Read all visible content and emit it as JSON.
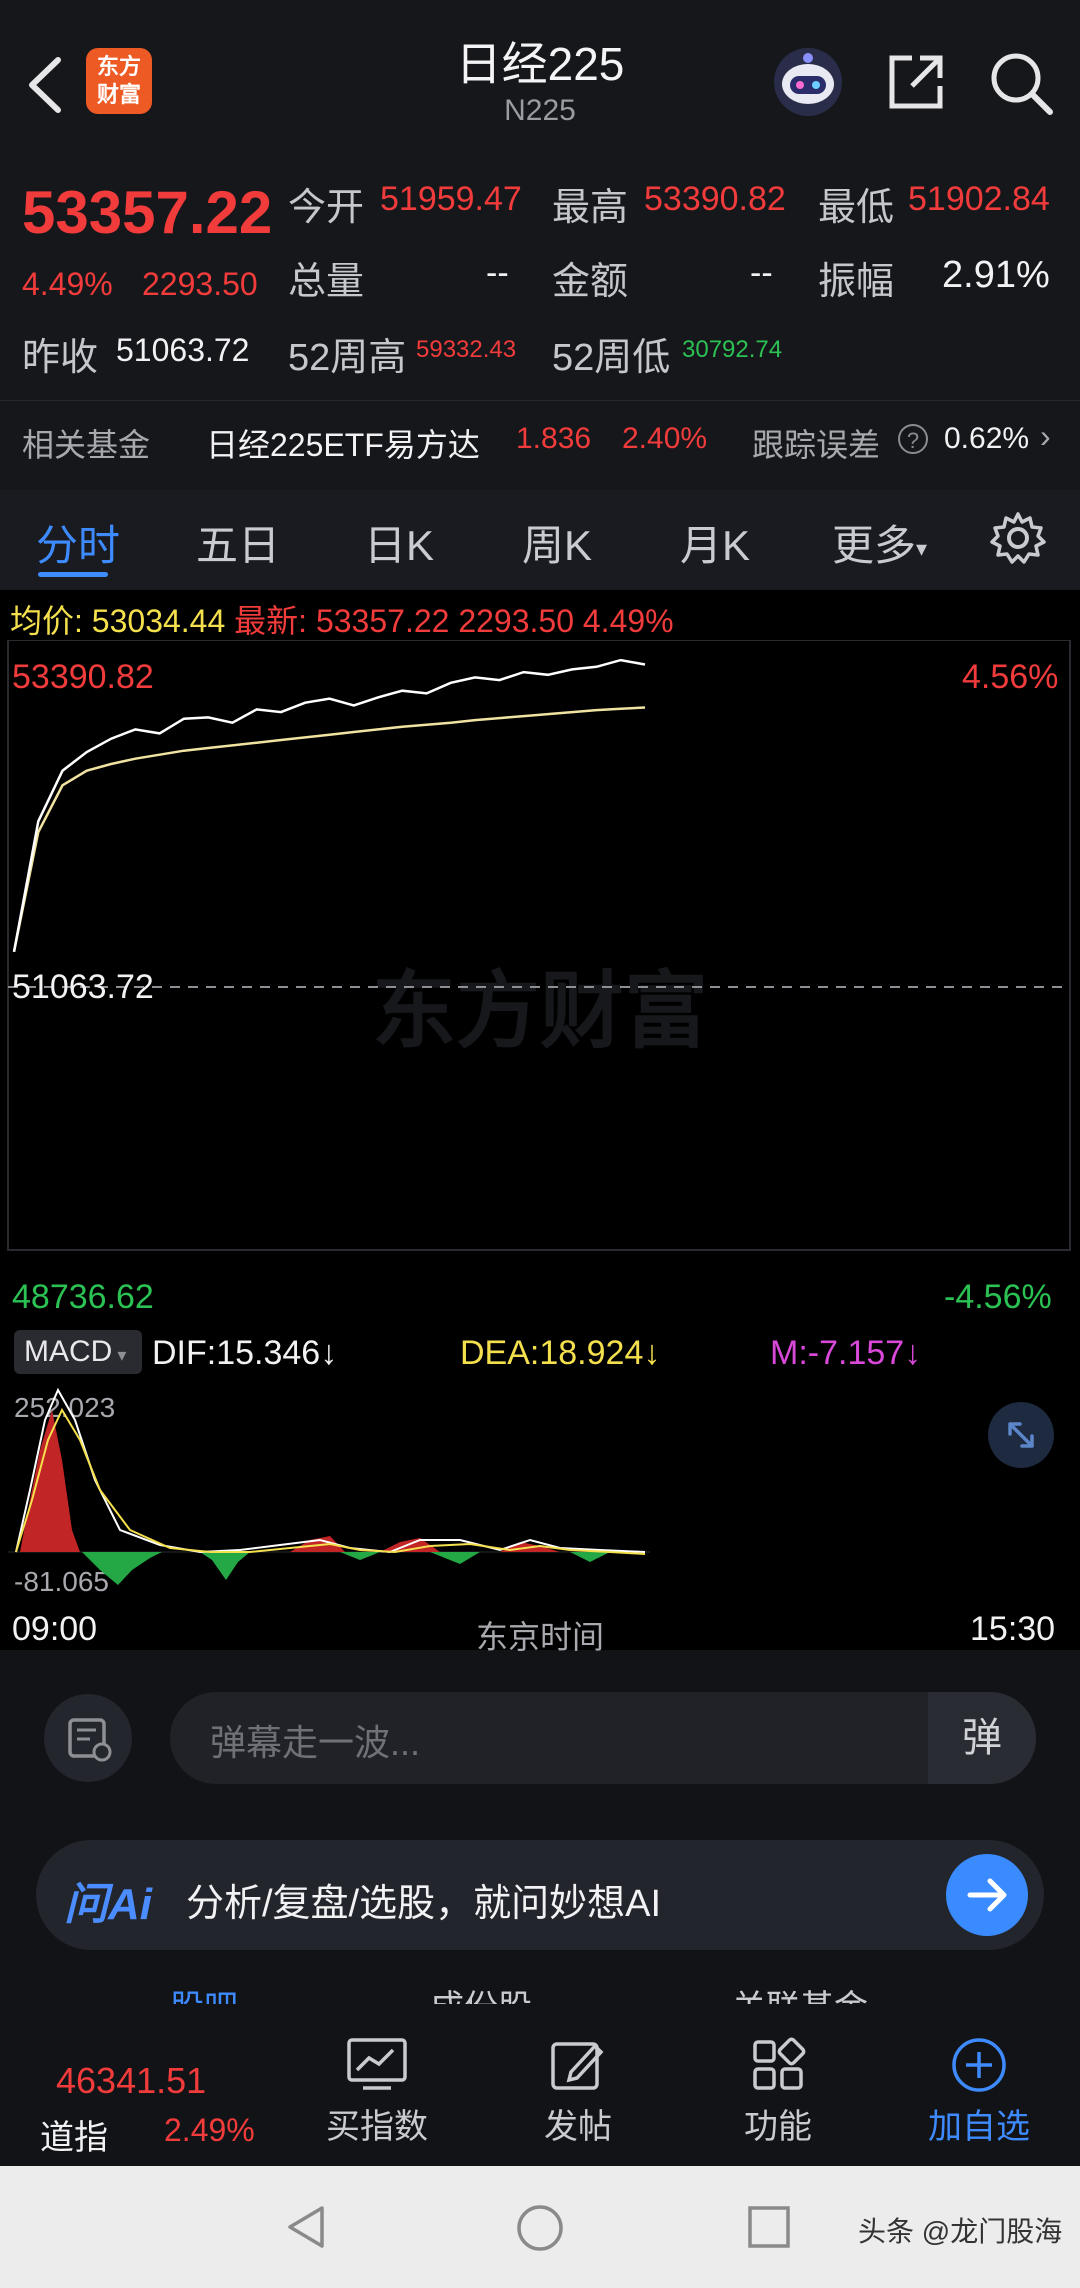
{
  "header": {
    "title": "日经225",
    "subtitle": "N225",
    "logo_text_1": "东方",
    "logo_text_2": "财富"
  },
  "quote": {
    "price": "53357.22",
    "change_pct": "4.49%",
    "change_amt": "2293.50",
    "open_label": "今开",
    "open": "51959.47",
    "high_label": "最高",
    "high": "53390.82",
    "low_label": "最低",
    "low": "51902.84",
    "volume_label": "总量",
    "volume": "--",
    "amount_label": "金额",
    "amount": "--",
    "amplitude_label": "振幅",
    "amplitude": "2.91%",
    "prev_close_label": "昨收",
    "prev_close": "51063.72",
    "w52_high_label": "52周高",
    "w52_high": "59332.43",
    "w52_low_label": "52周低",
    "w52_low": "30792.74"
  },
  "related_fund": {
    "label": "相关基金",
    "name": "日经225ETF易方达",
    "price": "1.836",
    "pct": "2.40%",
    "tracking_label": "跟踪误差",
    "tracking": "0.62%"
  },
  "tabs": [
    {
      "label": "分时"
    },
    {
      "label": "五日"
    },
    {
      "label": "日K"
    },
    {
      "label": "周K"
    },
    {
      "label": "月K"
    },
    {
      "label": "更多"
    }
  ],
  "chart_info": {
    "avg_label": "均价:",
    "avg": "53034.44",
    "latest_label": "最新:",
    "latest": "53357.22",
    "chg": "2293.50",
    "pct": "4.49%"
  },
  "chart_data": {
    "type": "line",
    "y_top": "53390.82",
    "y_mid": "51063.72",
    "y_bottom": "48736.62",
    "pct_top": "4.56%",
    "pct_bottom": "-4.56%",
    "watermark": "东方财富",
    "series": [
      {
        "name": "最新",
        "color": "#ffffff",
        "values": [
          51200,
          52180,
          52560,
          52700,
          52800,
          52870,
          52840,
          52950,
          52960,
          52920,
          53020,
          53000,
          53070,
          53100,
          53050,
          53110,
          53160,
          53140,
          53220,
          53260,
          53240,
          53300,
          53280,
          53320,
          53340,
          53390,
          53357
        ]
      },
      {
        "name": "均价",
        "color": "#f0e2a0",
        "values": [
          51200,
          52100,
          52450,
          52560,
          52610,
          52650,
          52680,
          52710,
          52730,
          52750,
          52770,
          52790,
          52810,
          52830,
          52850,
          52870,
          52890,
          52905,
          52920,
          52940,
          52955,
          52970,
          52985,
          53000,
          53015,
          53025,
          53034
        ]
      }
    ]
  },
  "macd": {
    "label": "MACD",
    "dif": "DIF:15.346↓",
    "dea": "DEA:18.924↓",
    "m": "M:-7.157↓",
    "max": "252.023",
    "min": "-81.065"
  },
  "time_axis": {
    "start": "09:00",
    "center": "东京时间",
    "end": "15:30"
  },
  "danmu": {
    "placeholder": "弹幕走一波...",
    "btn": "弹"
  },
  "ai": {
    "brand": "问Ai",
    "text": "分析/复盘/选股，就问妙想AI"
  },
  "subtabs": [
    "股吧",
    "成份股",
    "关联基金"
  ],
  "bottom": {
    "dji_price": "46341.51",
    "dji_label": "道指",
    "dji_pct": "2.49%",
    "buy_index": "买指数",
    "post": "发帖",
    "function": "功能",
    "add_watch": "加自选"
  },
  "watermark_corner": "头条 @龙门股海"
}
